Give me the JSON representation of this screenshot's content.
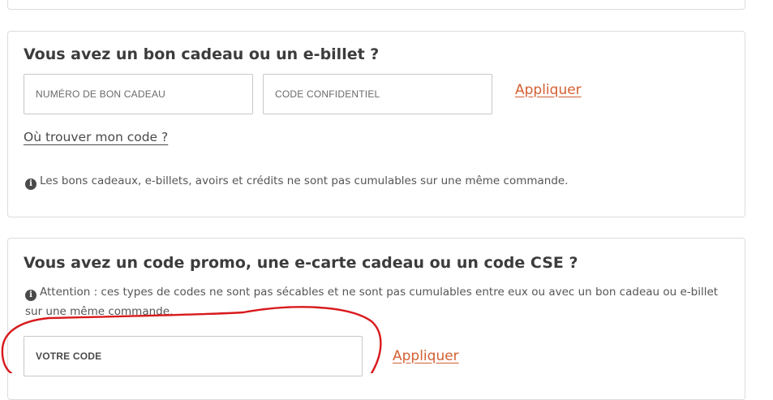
{
  "gift_section": {
    "title": "Vous avez un bon cadeau ou un e-billet ?",
    "voucher_number_placeholder": "NUMÉRO DE BON CADEAU",
    "voucher_number_value": "",
    "confidential_code_placeholder": "CODE CONFIDENTIEL",
    "confidential_code_value": "",
    "apply_label": "Appliquer",
    "help_link": "Où trouver mon code ?",
    "info_text": "Les bons cadeaux, e-billets, avoirs et crédits ne sont pas cumulables sur une même commande.",
    "info_icon": "info-icon"
  },
  "promo_section": {
    "title": "Vous avez un code promo, une e-carte cadeau ou un code CSE ?",
    "info_text": "Attention : ces types de codes ne sont pas sécables et ne sont pas cumulables entre eux ou avec un bon cadeau ou e-billet sur une même commande.",
    "info_icon": "info-icon",
    "code_placeholder": "VOTRE CODE",
    "code_value": "",
    "apply_label": "Appliquer"
  },
  "colors": {
    "accent_link": "#d35f32",
    "annotation_stroke": "#d8191c",
    "title_text": "#3c3c3c",
    "body_text": "#555555",
    "border": "#dcdcdc"
  }
}
